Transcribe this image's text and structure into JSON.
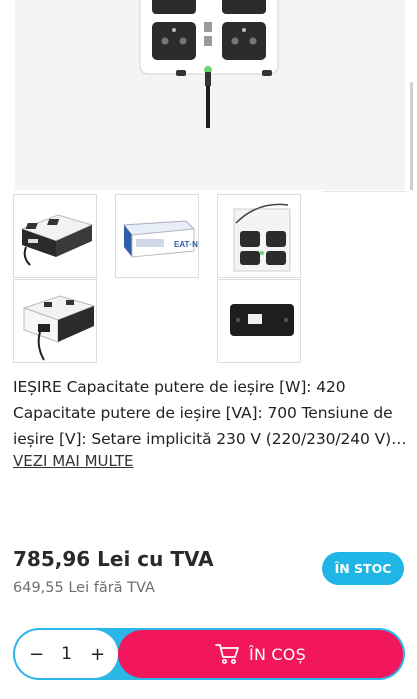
{
  "gallery": {
    "thumbnails": [
      "ups-angle-icon",
      "ups-box-icon",
      "ups-top-icon",
      "ups-rear-icon",
      "ups-bottom-icon"
    ]
  },
  "description": {
    "text": "IEȘIRE Capacitate putere de ieșire [W]: 420 Capacitate putere de ieșire [VA]: 700 Tensiune de ieșire [V]: Setare implicită 230 V (220/230/240 V)…",
    "more_label": "VEZI MAI MULTE"
  },
  "pricing": {
    "price_with_vat": "785,96 Lei cu TVA",
    "price_without_vat": "649,55 Lei fără TVA",
    "stock_badge": "ÎN STOC"
  },
  "cart": {
    "minus_label": "−",
    "quantity": "1",
    "plus_label": "+",
    "add_label": "ÎN COȘ"
  },
  "colors": {
    "stock": "#20b5e4",
    "add_to_cart": "#f2175c",
    "cart_border": "#2ab6e6"
  }
}
